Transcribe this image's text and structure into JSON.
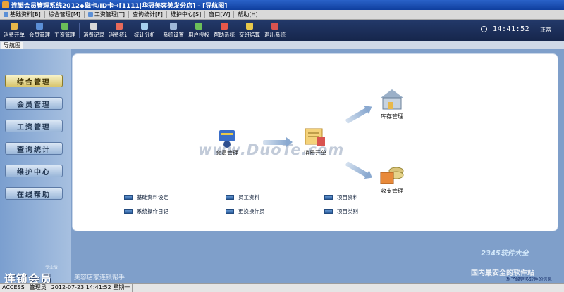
{
  "window": {
    "title": "连锁会员管理系统2012◆磁卡/ID卡→[1111|华冠美容美发分店] - [导航图]"
  },
  "menu": [
    "基础资料[B]",
    "综合管理[M]",
    "工资管理[T]",
    "查询统计[F]",
    "维护中心[S]",
    "窗口[W]",
    "帮助[H]"
  ],
  "toolbar": {
    "groups": [
      [
        {
          "label": "消费开单",
          "color": "#e8b84a"
        },
        {
          "label": "会员管理",
          "color": "#5b8fd6"
        },
        {
          "label": "工资管理",
          "color": "#6bbf59"
        }
      ],
      [
        {
          "label": "消费记录",
          "color": "#d9d9d9"
        },
        {
          "label": "消费统计",
          "color": "#e86a5a"
        },
        {
          "label": "统计分析",
          "color": "#a8d0f0"
        }
      ],
      [
        {
          "label": "系统设置",
          "color": "#9fb8d8"
        },
        {
          "label": "用户授权",
          "color": "#6bbf59"
        },
        {
          "label": "帮助系统",
          "color": "#e8584a"
        },
        {
          "label": "交班结算",
          "color": "#e8c84a"
        },
        {
          "label": "退出系统",
          "color": "#d9534f"
        }
      ]
    ],
    "clock": "14:41:52",
    "status": "正常"
  },
  "nav_tab": "导航图",
  "sidebar": {
    "items": [
      "综合管理",
      "会员管理",
      "工资管理",
      "查询统计",
      "维护中心",
      "在线帮助"
    ],
    "active_index": 0,
    "brand": "连锁会员",
    "brand_small": "专业版"
  },
  "flow": {
    "nodes": {
      "member": "会员管理",
      "consume": "消费开单",
      "inventory": "库存管理",
      "cashier": "收支管理"
    },
    "watermark": "www.DuoTe.com"
  },
  "links": [
    {
      "label": "基础资料设定"
    },
    {
      "label": "员工资料"
    },
    {
      "label": "项目资料"
    },
    {
      "label": "系统操作日记"
    },
    {
      "label": "更换操作员"
    },
    {
      "label": "项目类别"
    }
  ],
  "footer": {
    "more_link": "想了解更多软件的信息",
    "promo_site": "2345软件大全",
    "promo_slogan": "国内最安全的软件站",
    "promo_tag": "美容店家连锁帮手"
  },
  "statusbar": [
    "ACCESS",
    "管理员",
    "2012-07-23 14:41:52 星期一"
  ]
}
